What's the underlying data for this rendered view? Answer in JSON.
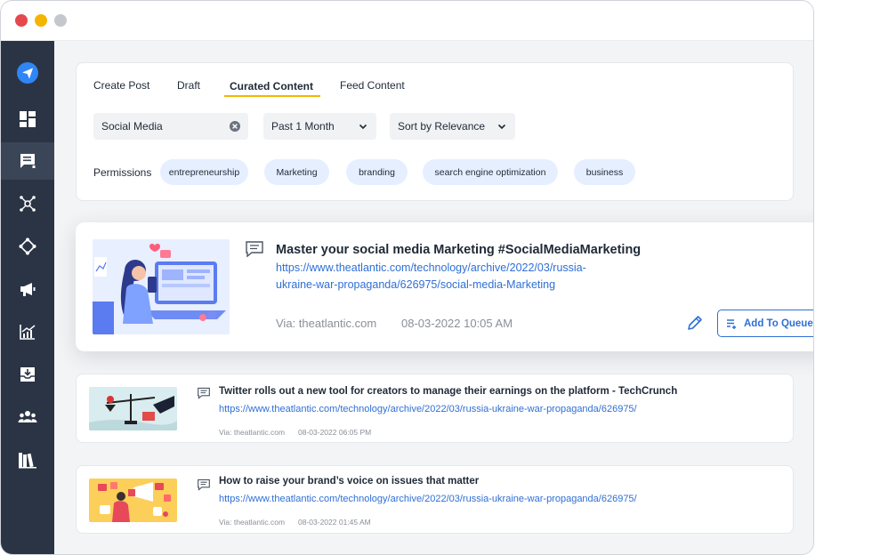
{
  "colors": {
    "accent": "#2f6fd6",
    "tab_underline": "#f5b400",
    "sidebar": "#2b3445",
    "chip": "#e6efff"
  },
  "window_controls": [
    "close",
    "minimize",
    "zoom"
  ],
  "sidebar": {
    "items": [
      {
        "icon": "send-icon",
        "active": false
      },
      {
        "icon": "dashboard-icon",
        "active": false
      },
      {
        "icon": "posts-icon",
        "active": true
      },
      {
        "icon": "network-icon",
        "active": false
      },
      {
        "icon": "move-icon",
        "active": false
      },
      {
        "icon": "megaphone-icon",
        "active": false
      },
      {
        "icon": "analytics-icon",
        "active": false
      },
      {
        "icon": "inbox-download-icon",
        "active": false
      },
      {
        "icon": "team-icon",
        "active": false
      },
      {
        "icon": "library-icon",
        "active": false
      }
    ]
  },
  "tabs": [
    {
      "label": "Create Post",
      "active": false
    },
    {
      "label": "Draft",
      "active": false
    },
    {
      "label": "Curated Content",
      "active": true
    },
    {
      "label": "Feed Content",
      "active": false
    }
  ],
  "filters": {
    "search_value": "Social Media",
    "date_range": "Past 1 Month",
    "sort": "Sort by Relevance"
  },
  "permissions": {
    "label": "Permissions",
    "tags": [
      "entrepreneurship",
      "Marketing",
      "branding",
      "search engine optimization",
      "business"
    ]
  },
  "posts": [
    {
      "title": "Master your social media Marketing #SocialMediaMarketing",
      "link_line1": "https://www.theatlantic.com/technology/archive/2022/03/russia-",
      "link_line2": "ukraine-war-propaganda/626975/social-media-Marketing",
      "via": "Via: theatlantic.com",
      "date": "08-03-2022 10:05 AM",
      "action_label": "Add To Queue"
    },
    {
      "title": "Twitter rolls out a new tool for creators to manage their earnings on the platform - TechCrunch",
      "link": "https://www.theatlantic.com/technology/archive/2022/03/russia-ukraine-war-propaganda/626975/",
      "via": "Via: theatlantic.com",
      "date": "08-03-2022 06:05 PM"
    },
    {
      "title": "How to raise your brand’s voice on issues that matter",
      "link": "https://www.theatlantic.com/technology/archive/2022/03/russia-ukraine-war-propaganda/626975/",
      "via": "Via: theatlantic.com",
      "date": "08-03-2022 01:45 AM"
    }
  ]
}
